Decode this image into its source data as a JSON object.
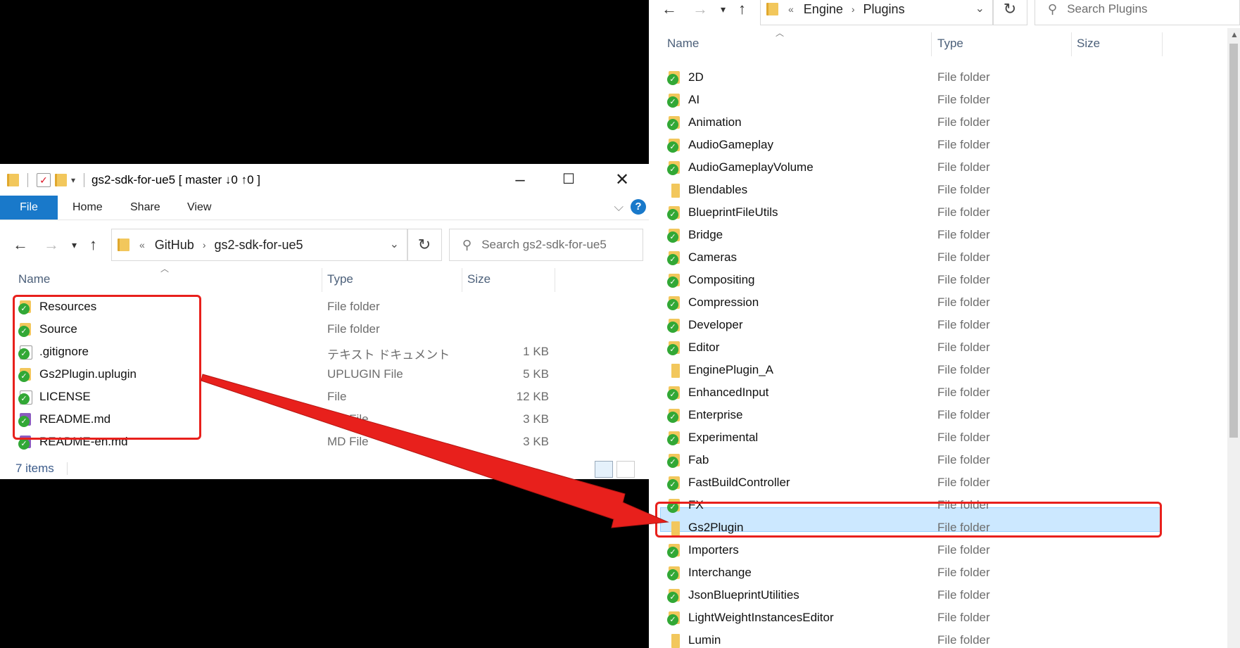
{
  "left": {
    "title": "gs2-sdk-for-ue5 [ master ↓0 ↑0 ]",
    "ribbon": [
      "File",
      "Home",
      "Share",
      "View"
    ],
    "address": {
      "lead": "«",
      "crumbs": [
        "GitHub",
        "gs2-sdk-for-ue5"
      ]
    },
    "search_placeholder": "Search gs2-sdk-for-ue5",
    "columns": {
      "name": "Name",
      "type": "Type",
      "size": "Size"
    },
    "files": [
      {
        "name": "Resources",
        "type": "File folder",
        "size": "",
        "icon": "folder-synced-icon"
      },
      {
        "name": "Source",
        "type": "File folder",
        "size": "",
        "icon": "folder-synced-icon"
      },
      {
        "name": ".gitignore",
        "type": "テキスト ドキュメント",
        "size": "1 KB",
        "icon": "text-file-synced-icon"
      },
      {
        "name": "Gs2Plugin.uplugin",
        "type": "UPLUGIN File",
        "size": "5 KB",
        "icon": "uplugin-file-synced-icon"
      },
      {
        "name": "LICENSE",
        "type": "File",
        "size": "12 KB",
        "icon": "file-synced-icon"
      },
      {
        "name": "README.md",
        "type": "MD File",
        "size": "3 KB",
        "icon": "md-file-synced-icon"
      },
      {
        "name": "README-en.md",
        "type": "MD File",
        "size": "3 KB",
        "icon": "md-file-synced-icon"
      }
    ],
    "status": "7 items"
  },
  "right": {
    "address": {
      "lead": "«",
      "crumbs": [
        "Engine",
        "Plugins"
      ]
    },
    "search_placeholder": "Search Plugins",
    "columns": {
      "name": "Name",
      "type": "Type",
      "size": "Size"
    },
    "files": [
      {
        "name": "2D",
        "type": "File folder",
        "synced": true
      },
      {
        "name": "AI",
        "type": "File folder",
        "synced": true
      },
      {
        "name": "Animation",
        "type": "File folder",
        "synced": true
      },
      {
        "name": "AudioGameplay",
        "type": "File folder",
        "synced": true
      },
      {
        "name": "AudioGameplayVolume",
        "type": "File folder",
        "synced": true
      },
      {
        "name": "Blendables",
        "type": "File folder",
        "synced": false
      },
      {
        "name": "BlueprintFileUtils",
        "type": "File folder",
        "synced": true
      },
      {
        "name": "Bridge",
        "type": "File folder",
        "synced": true
      },
      {
        "name": "Cameras",
        "type": "File folder",
        "synced": true
      },
      {
        "name": "Compositing",
        "type": "File folder",
        "synced": true
      },
      {
        "name": "Compression",
        "type": "File folder",
        "synced": true
      },
      {
        "name": "Developer",
        "type": "File folder",
        "synced": true
      },
      {
        "name": "Editor",
        "type": "File folder",
        "synced": true
      },
      {
        "name": "EnginePlugin_A",
        "type": "File folder",
        "synced": false
      },
      {
        "name": "EnhancedInput",
        "type": "File folder",
        "synced": true
      },
      {
        "name": "Enterprise",
        "type": "File folder",
        "synced": true
      },
      {
        "name": "Experimental",
        "type": "File folder",
        "synced": true
      },
      {
        "name": "Fab",
        "type": "File folder",
        "synced": true
      },
      {
        "name": "FastBuildController",
        "type": "File folder",
        "synced": true
      },
      {
        "name": "FX",
        "type": "File folder",
        "synced": true
      },
      {
        "name": "Gs2Plugin",
        "type": "File folder",
        "synced": false,
        "selected": true
      },
      {
        "name": "Importers",
        "type": "File folder",
        "synced": true
      },
      {
        "name": "Interchange",
        "type": "File folder",
        "synced": true
      },
      {
        "name": "JsonBlueprintUtilities",
        "type": "File folder",
        "synced": true
      },
      {
        "name": "LightWeightInstancesEditor",
        "type": "File folder",
        "synced": true
      },
      {
        "name": "Lumin",
        "type": "File folder",
        "synced": false
      }
    ]
  },
  "colors": {
    "highlight": "#e8201c",
    "accent": "#1979ca",
    "selection": "#cce8ff"
  }
}
